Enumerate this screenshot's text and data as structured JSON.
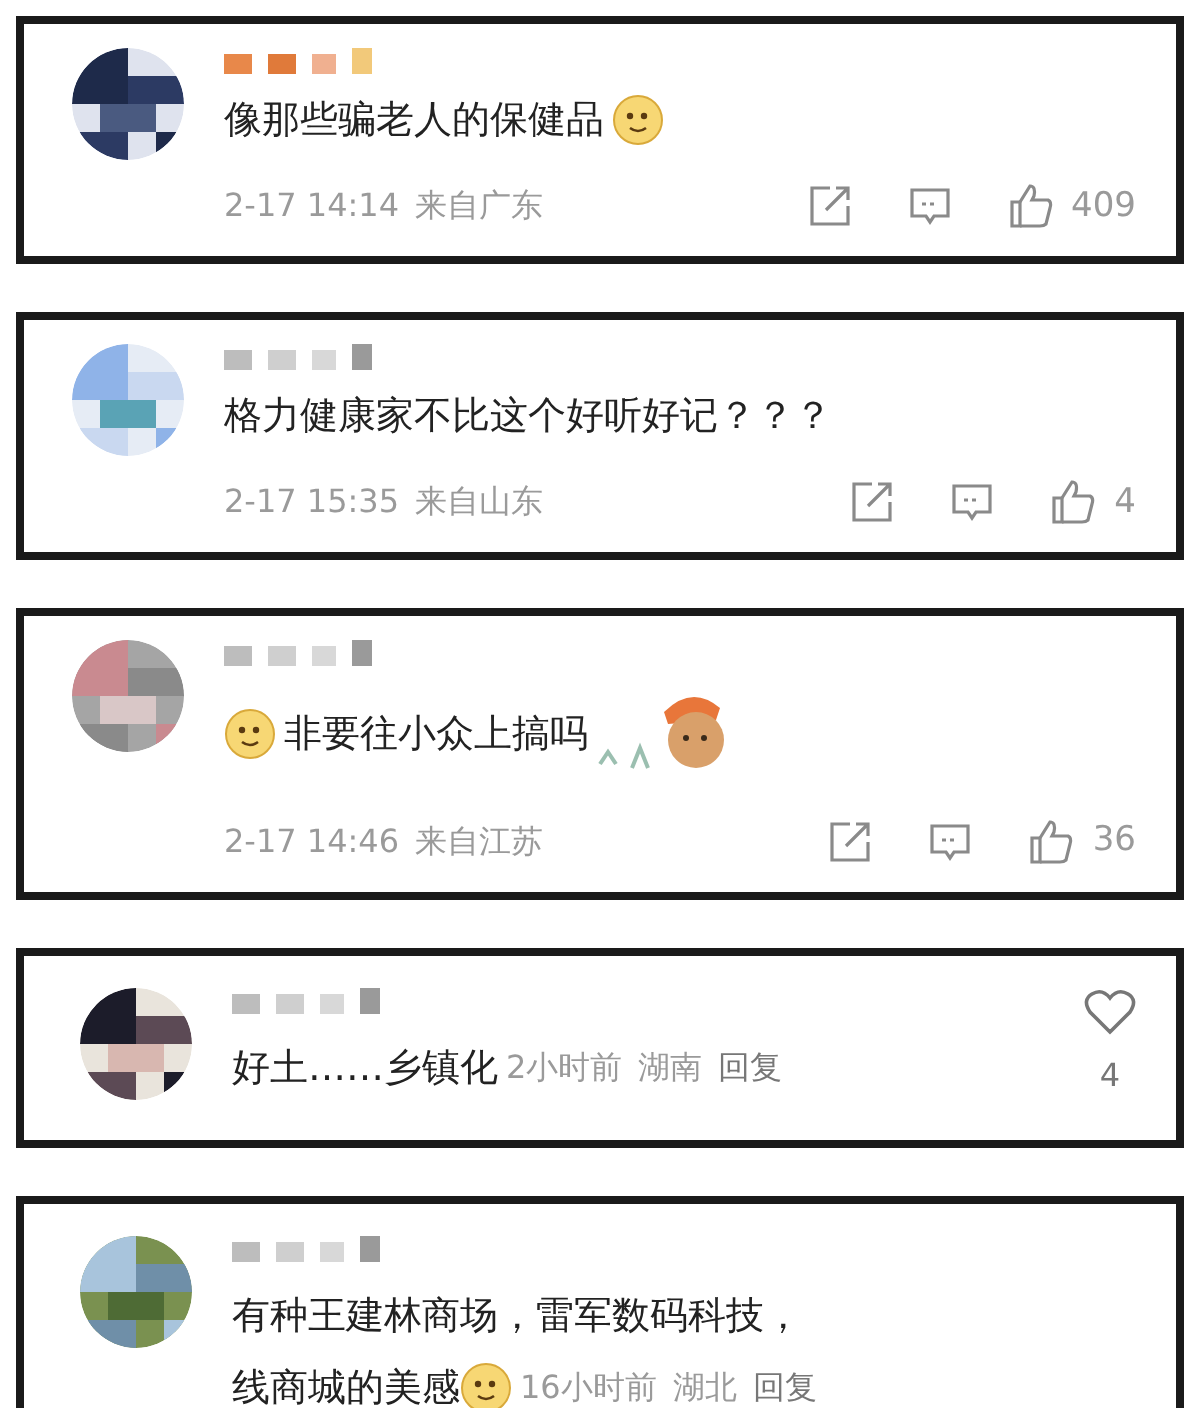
{
  "comments": [
    {
      "kind": "weibo",
      "text": [
        "像那些骗老人的保健品"
      ],
      "trailing_emoji": true,
      "time": "2-17 14:14",
      "location": "来自广东",
      "likes": "409"
    },
    {
      "kind": "weibo",
      "text": [
        "格力健康家不比这个好听好记？？？"
      ],
      "time": "2-17 15:35",
      "location": "来自山东",
      "likes": "4"
    },
    {
      "kind": "weibo",
      "text": [
        "非要往小众上搞吗"
      ],
      "leading_emoji": true,
      "sticker": true,
      "time": "2-17 14:46",
      "location": "来自江苏",
      "likes": "36"
    },
    {
      "kind": "douyin",
      "text": [
        "好土……乡镇化"
      ],
      "time": "2小时前",
      "location": "湖南",
      "reply": "回复",
      "likes": "4"
    },
    {
      "kind": "douyin",
      "text": [
        "有种王建林商场，雷军数码科技，",
        "线商城的美感"
      ],
      "trailing_emoji": true,
      "time": "16小时前",
      "location": "湖北",
      "reply": "回复"
    }
  ]
}
